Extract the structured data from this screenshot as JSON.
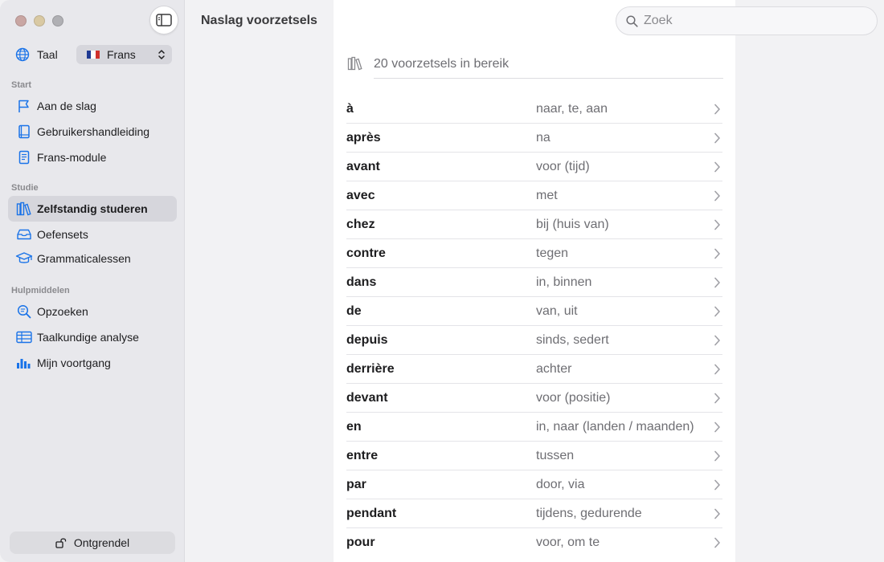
{
  "header": {
    "title": "Naslag voorzetsels",
    "search_placeholder": "Zoek"
  },
  "sidebar": {
    "language_label": "Taal",
    "language_value": "Frans",
    "sections": [
      {
        "title": "Start",
        "items": [
          {
            "label": "Aan de slag",
            "icon": "flag-icon"
          },
          {
            "label": "Gebruikershandleiding",
            "icon": "book-icon"
          },
          {
            "label": "Frans-module",
            "icon": "document-icon"
          }
        ]
      },
      {
        "title": "Studie",
        "items": [
          {
            "label": "Zelfstandig studeren",
            "icon": "books-icon",
            "active": true
          },
          {
            "label": "Oefensets",
            "icon": "tray-icon"
          },
          {
            "label": "Grammaticalessen",
            "icon": "graduation-cap-icon"
          }
        ]
      },
      {
        "title": "Hulpmiddelen",
        "items": [
          {
            "label": "Opzoeken",
            "icon": "magnifier-text-icon"
          },
          {
            "label": "Taalkundige analyse",
            "icon": "table-icon"
          },
          {
            "label": "Mijn voortgang",
            "icon": "bar-chart-icon"
          }
        ]
      }
    ],
    "unlock_label": "Ontgrendel"
  },
  "content": {
    "range_text": "20 voorzetsels in bereik",
    "prepositions": [
      {
        "term": "à",
        "translation": "naar, te, aan"
      },
      {
        "term": "après",
        "translation": "na"
      },
      {
        "term": "avant",
        "translation": "voor (tijd)"
      },
      {
        "term": "avec",
        "translation": "met"
      },
      {
        "term": "chez",
        "translation": "bij (huis van)"
      },
      {
        "term": "contre",
        "translation": "tegen"
      },
      {
        "term": "dans",
        "translation": "in, binnen"
      },
      {
        "term": "de",
        "translation": "van, uit"
      },
      {
        "term": "depuis",
        "translation": "sinds, sedert"
      },
      {
        "term": "derrière",
        "translation": "achter"
      },
      {
        "term": "devant",
        "translation": "voor (positie)"
      },
      {
        "term": "en",
        "translation": "in, naar (landen / maanden)"
      },
      {
        "term": "entre",
        "translation": "tussen"
      },
      {
        "term": "par",
        "translation": "door, via"
      },
      {
        "term": "pendant",
        "translation": "tijdens, gedurende"
      },
      {
        "term": "pour",
        "translation": "voor, om te"
      }
    ]
  },
  "colors": {
    "accent": "#1a73e8",
    "sidebar_bg": "#e8e8ec",
    "active_item_bg": "#d6d6dc"
  }
}
